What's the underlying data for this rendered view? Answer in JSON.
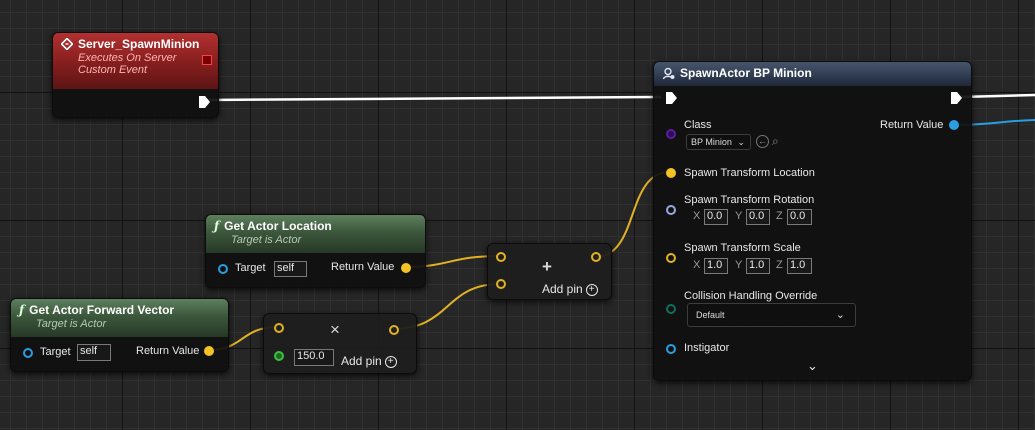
{
  "event_node": {
    "title": "Server_SpawnMinion",
    "subtitle_line1": "Executes On Server",
    "subtitle_line2": "Custom Event",
    "icon": "event-diamond-icon",
    "color": "#9e2020"
  },
  "get_location_node": {
    "title": "Get Actor Location",
    "subtitle": "Target is Actor",
    "icon": "function-icon",
    "target_label": "Target",
    "target_value": "self",
    "return_label": "Return Value"
  },
  "forward_vector_node": {
    "title": "Get Actor Forward Vector",
    "subtitle": "Target is Actor",
    "icon": "function-icon",
    "target_label": "Target",
    "target_value": "self",
    "return_label": "Return Value"
  },
  "add_node": {
    "symbol": "+",
    "add_pin_label": "Add pin",
    "add_icon": "plus-circle-icon"
  },
  "multiply_node": {
    "symbol": "×",
    "input_value": "150.0",
    "add_pin_label": "Add pin",
    "add_icon": "plus-circle-icon"
  },
  "spawn_node": {
    "title": "SpawnActor BP Minion",
    "icon": "spawn-actor-icon",
    "class_label": "Class",
    "class_value": "BP Minion",
    "return_label": "Return Value",
    "location_label": "Spawn Transform Location",
    "rotation_label": "Spawn Transform Rotation",
    "rotation": {
      "x_label": "X",
      "x": "0.0",
      "y_label": "Y",
      "y": "0.0",
      "z_label": "Z",
      "z": "0.0"
    },
    "scale_label": "Spawn Transform Scale",
    "scale": {
      "x_label": "X",
      "x": "1.0",
      "y_label": "Y",
      "y": "1.0",
      "z_label": "Z",
      "z": "1.0"
    },
    "collision_label": "Collision Handling Override",
    "collision_value": "Default",
    "instigator_label": "Instigator",
    "expand_icon": "chevron-down-icon"
  },
  "colors": {
    "exec_wire": "#ffffff",
    "vector_wire": "#e0b224",
    "object_wire": "#2a9ee0",
    "event_header": "#9e2020",
    "function_header": "#3c573c",
    "spawn_header": "#2e3a4f"
  }
}
